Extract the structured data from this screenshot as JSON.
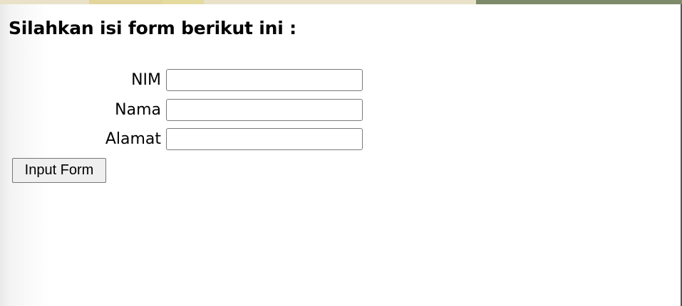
{
  "heading": "Silahkan isi form berikut ini :",
  "form": {
    "fields": [
      {
        "label": "NIM",
        "value": "",
        "placeholder": ""
      },
      {
        "label": "Nama",
        "value": "",
        "placeholder": ""
      },
      {
        "label": "Alamat",
        "value": "",
        "placeholder": ""
      }
    ],
    "submit_label": "Input Form"
  },
  "colors": {
    "strip_background": "#e9e2c9",
    "strip_yellow": "#e2d69d",
    "strip_green": "#7e8b6a",
    "button_background": "#efefef",
    "input_border": "#7a7a7a"
  }
}
